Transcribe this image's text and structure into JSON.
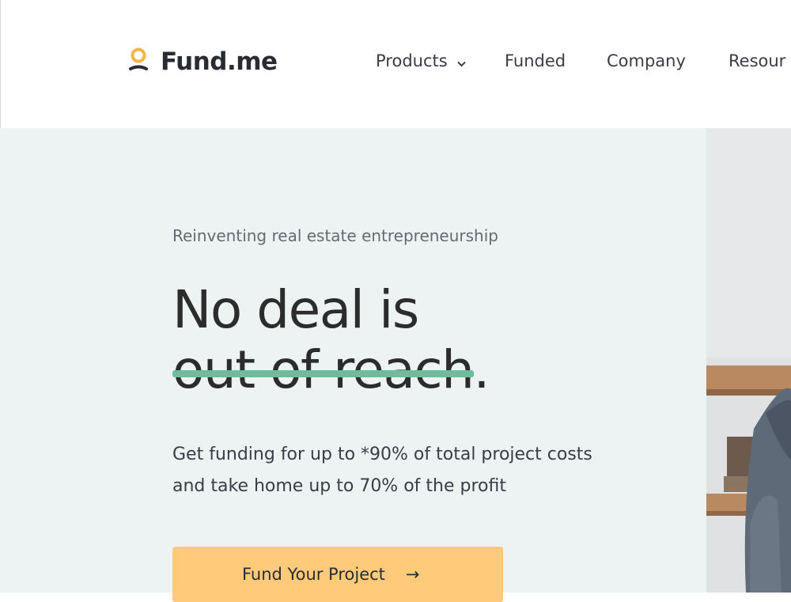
{
  "brand": {
    "name": "Fund.me",
    "logo_color": "#f5b546"
  },
  "nav": {
    "items": [
      {
        "label": "Products",
        "has_dropdown": true
      },
      {
        "label": "Funded"
      },
      {
        "label": "Company"
      },
      {
        "label": "Resour"
      }
    ]
  },
  "hero": {
    "eyebrow": "Reinventing real estate entrepreneurship",
    "headline_line1": "No deal is",
    "headline_struck": "out of reach",
    "headline_end": ".",
    "subcopy": "Get funding for up to *90% of total project costs and take home up to 70% of the profit",
    "cta_label": "Fund Your Project",
    "cta_icon": "arrow-right-icon",
    "strike_color": "#6fbc9c",
    "cta_color": "#ffca7a",
    "background": "#edf3f3"
  }
}
